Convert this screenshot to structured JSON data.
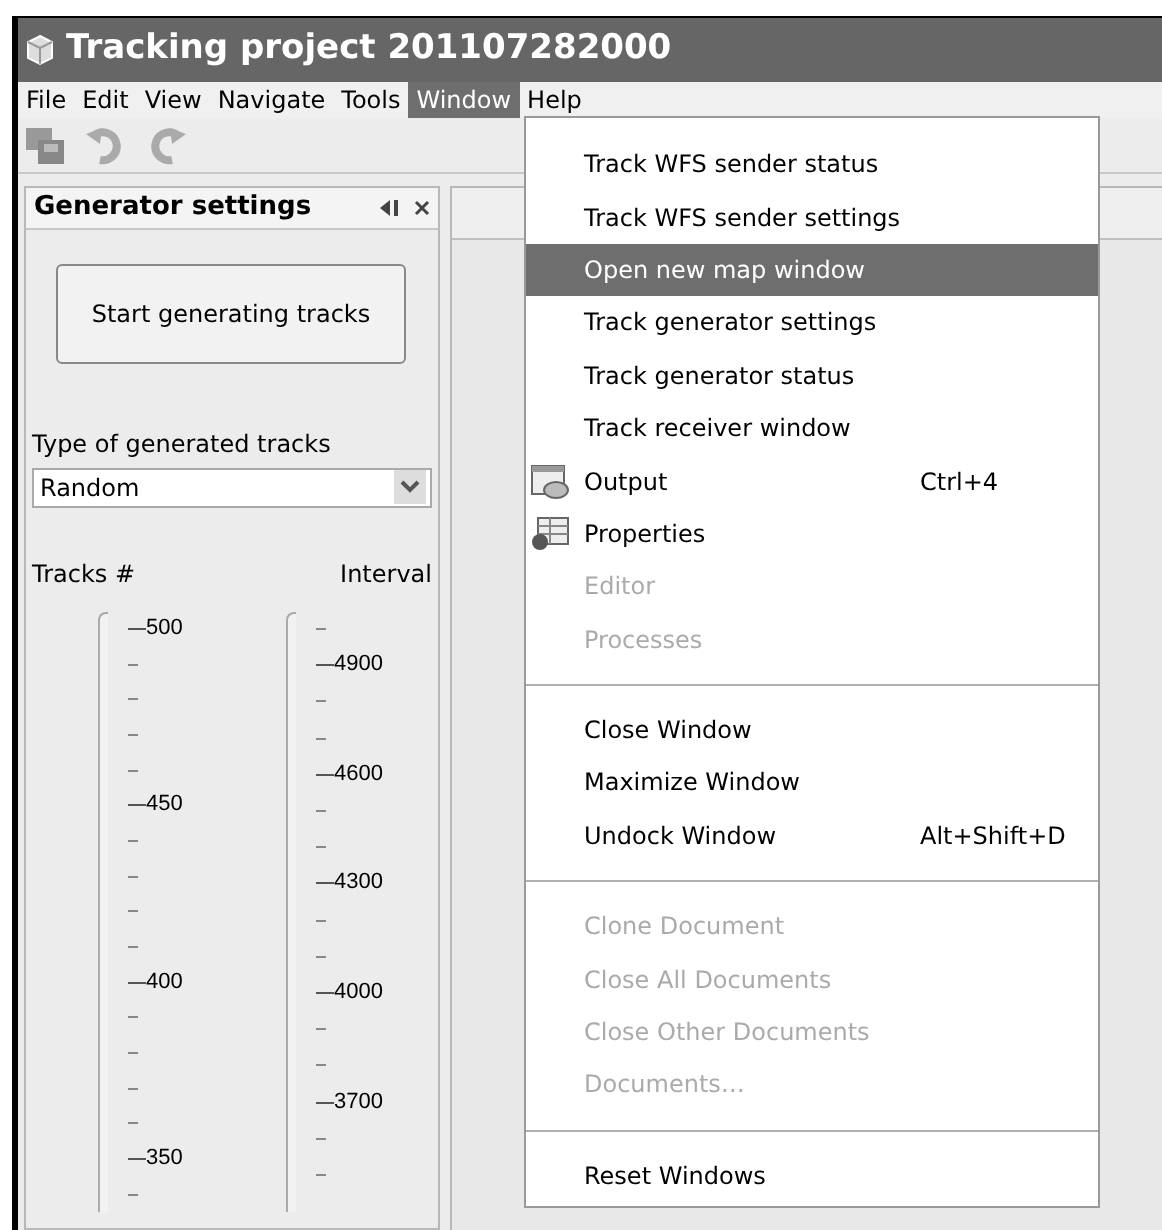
{
  "window": {
    "title": "Tracking project 201107282000"
  },
  "menu_bar": [
    {
      "label": "File",
      "selected": false
    },
    {
      "label": "Edit",
      "selected": false
    },
    {
      "label": "View",
      "selected": false
    },
    {
      "label": "Navigate",
      "selected": false
    },
    {
      "label": "Tools",
      "selected": false
    },
    {
      "label": "Window",
      "selected": true
    },
    {
      "label": "Help",
      "selected": false
    }
  ],
  "panel": {
    "title": "Generator settings",
    "button": "Start generating tracks",
    "type_label": "Type of generated tracks",
    "type_value": "Random",
    "sliders": [
      {
        "label": "Tracks #",
        "ticks": [
          "500",
          "450",
          "400",
          "350"
        ]
      },
      {
        "label": "Interval",
        "ticks": [
          "4900",
          "4600",
          "4300",
          "4000",
          "3700"
        ]
      }
    ]
  },
  "window_menu": [
    {
      "kind": "item",
      "label": "Track WFS sender status",
      "disabled": false,
      "selected": false
    },
    {
      "kind": "item",
      "label": "Track WFS sender settings",
      "disabled": false,
      "selected": false
    },
    {
      "kind": "item",
      "label": "Open new map window",
      "disabled": false,
      "selected": true
    },
    {
      "kind": "item",
      "label": "Track generator settings",
      "disabled": false,
      "selected": false
    },
    {
      "kind": "item",
      "label": "Track generator status",
      "disabled": false,
      "selected": false
    },
    {
      "kind": "item",
      "label": "Track receiver window",
      "disabled": false,
      "selected": false
    },
    {
      "kind": "console_item",
      "label": "Output",
      "shortcut": "Ctrl+4",
      "disabled": false,
      "selected": false
    },
    {
      "kind": "properties_item",
      "label": "Properties",
      "disabled": false,
      "selected": false
    },
    {
      "kind": "item",
      "label": "Editor",
      "disabled": true,
      "selected": false
    },
    {
      "kind": "item",
      "label": "Processes",
      "disabled": true,
      "selected": false
    },
    {
      "kind": "separator"
    },
    {
      "kind": "item",
      "label": "Close Window",
      "disabled": false,
      "selected": false
    },
    {
      "kind": "item",
      "label": "Maximize Window",
      "disabled": false,
      "selected": false
    },
    {
      "kind": "item",
      "label": "Undock Window",
      "shortcut": "Alt+Shift+D",
      "disabled": false,
      "selected": false
    },
    {
      "kind": "separator"
    },
    {
      "kind": "item",
      "label": "Clone Document",
      "disabled": true,
      "selected": false
    },
    {
      "kind": "item",
      "label": "Close All Documents",
      "disabled": true,
      "selected": false
    },
    {
      "kind": "item",
      "label": "Close Other Documents",
      "disabled": true,
      "selected": false
    },
    {
      "kind": "item",
      "label": "Documents…",
      "disabled": true,
      "selected": false
    },
    {
      "kind": "separator"
    },
    {
      "kind": "item",
      "label": "Reset Windows",
      "disabled": false,
      "selected": false
    }
  ]
}
